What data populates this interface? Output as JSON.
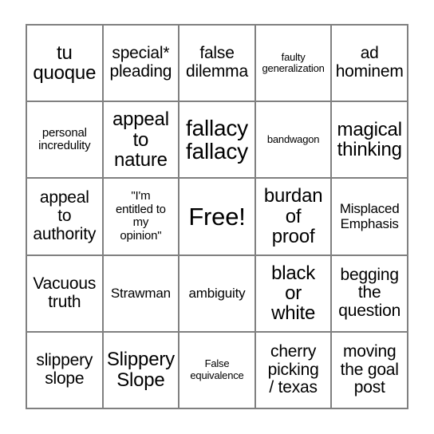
{
  "card": {
    "type": "bingo-card",
    "rows": 5,
    "columns": 5,
    "border_color": "#808080",
    "cell_background": "#ffffff",
    "text_color": "#000000",
    "page_background": "#ffffff",
    "free_space": {
      "row": 3,
      "column": 3,
      "label": "Free!"
    },
    "cells": [
      {
        "id": "r1c1",
        "text": "tu\nquoque",
        "size": "xl"
      },
      {
        "id": "r1c2",
        "text": "special*\npleading",
        "size": "l"
      },
      {
        "id": "r1c3",
        "text": "false\ndilemma",
        "size": "l"
      },
      {
        "id": "r1c4",
        "text": "faulty\ngeneralization",
        "size": "xs"
      },
      {
        "id": "r1c5",
        "text": "ad\nhominem",
        "size": "l"
      },
      {
        "id": "r2c1",
        "text": "personal\nincredulity",
        "size": "s"
      },
      {
        "id": "r2c2",
        "text": "appeal\nto\nnature",
        "size": "xl"
      },
      {
        "id": "r2c3",
        "text": "fallacy\nfallacy",
        "size": "xxl"
      },
      {
        "id": "r2c4",
        "text": "bandwagon",
        "size": "xs"
      },
      {
        "id": "r2c5",
        "text": "magical\nthinking",
        "size": "xl"
      },
      {
        "id": "r3c1",
        "text": "appeal\nto\nauthority",
        "size": "l"
      },
      {
        "id": "r3c2",
        "text": "\"I'm\nentitled to\nmy\nopinion\"",
        "size": "s"
      },
      {
        "id": "r3c3",
        "text": "Free!",
        "size": "free"
      },
      {
        "id": "r3c4",
        "text": "burdan\nof\nproof",
        "size": "xl"
      },
      {
        "id": "r3c5",
        "text": "Misplaced\nEmphasis",
        "size": "m"
      },
      {
        "id": "r4c1",
        "text": "Vacuous\ntruth",
        "size": "l"
      },
      {
        "id": "r4c2",
        "text": "Strawman",
        "size": "m"
      },
      {
        "id": "r4c3",
        "text": "ambiguity",
        "size": "m"
      },
      {
        "id": "r4c4",
        "text": "black\nor\nwhite",
        "size": "xl"
      },
      {
        "id": "r4c5",
        "text": "begging\nthe\nquestion",
        "size": "l"
      },
      {
        "id": "r5c1",
        "text": "slippery\nslope",
        "size": "l"
      },
      {
        "id": "r5c2",
        "text": "Slippery\nSlope",
        "size": "xl"
      },
      {
        "id": "r5c3",
        "text": "False\nequivalence",
        "size": "xs"
      },
      {
        "id": "r5c4",
        "text": "cherry\npicking\n/ texas",
        "size": "l"
      },
      {
        "id": "r5c5",
        "text": "moving\nthe goal\npost",
        "size": "l"
      }
    ]
  }
}
